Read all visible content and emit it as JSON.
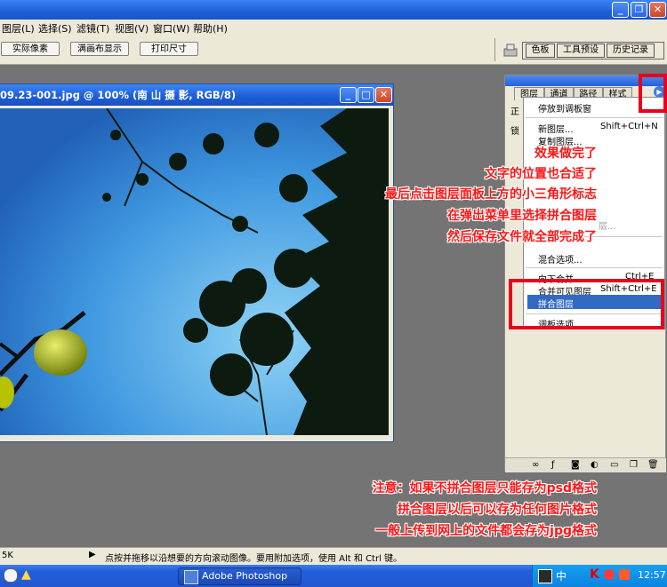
{
  "menubar": {
    "items": [
      "图层(L)",
      "选择(S)",
      "滤镜(T)",
      "视图(V)",
      "窗口(W)",
      "帮助(H)"
    ]
  },
  "options": {
    "actual_pixels": "实际像素",
    "fit_screen": "满画布显示",
    "print_size": "打印尺寸"
  },
  "palette_well": {
    "tabs": [
      "色板",
      "工具预设",
      "历史记录"
    ]
  },
  "document": {
    "title": "09.23-001.jpg @ 100% (南 山 摄 影, RGB/8)"
  },
  "layers_panel": {
    "tabs": [
      "图层",
      "通道",
      "路径",
      "样式"
    ],
    "row_fragments": [
      "正",
      "锁"
    ]
  },
  "flyout_menu": {
    "items": [
      {
        "label": "停放到调板窗",
        "shortcut": ""
      },
      {
        "label": "新图层...",
        "shortcut": "Shift+Ctrl+N"
      },
      {
        "label": "复制图层...",
        "shortcut": ""
      },
      {
        "label": "层...",
        "shortcut": ""
      },
      {
        "label": "混合选项...",
        "shortcut": ""
      },
      {
        "label": "向下合并",
        "shortcut": "Ctrl+E"
      },
      {
        "label": "合并可见图层",
        "shortcut": "Shift+Ctrl+E"
      },
      {
        "label": "拼合图层",
        "shortcut": ""
      },
      {
        "label": "调板选项...",
        "shortcut": ""
      }
    ]
  },
  "annotations": {
    "top": [
      "效果做完了",
      "文字的位置也合适了",
      "最后点击图层面板上方的小三角形标志",
      "在弹出菜单里选择拼合图层",
      "然后保存文件就全部完成了"
    ],
    "bottom": [
      "注意：如果不拼合图层只能存为psd格式",
      "拼合图层以后可以存为任何图片格式",
      "一般上传到网上的文件都会存为jpg格式"
    ]
  },
  "statusbar": {
    "left": "5K",
    "message": "点按并拖移以沿想要的方向滚动图像。要用附加选项，使用 Alt 和 Ctrl 键。"
  },
  "taskbar": {
    "task_label": "Adobe Photoshop",
    "ime": "中",
    "clock": "12:57"
  },
  "colors": {
    "annotation_red": "#ff1515",
    "highlight_box": "#e8001c",
    "selection_blue": "#316ac5",
    "xp_blue": "#245edb"
  }
}
